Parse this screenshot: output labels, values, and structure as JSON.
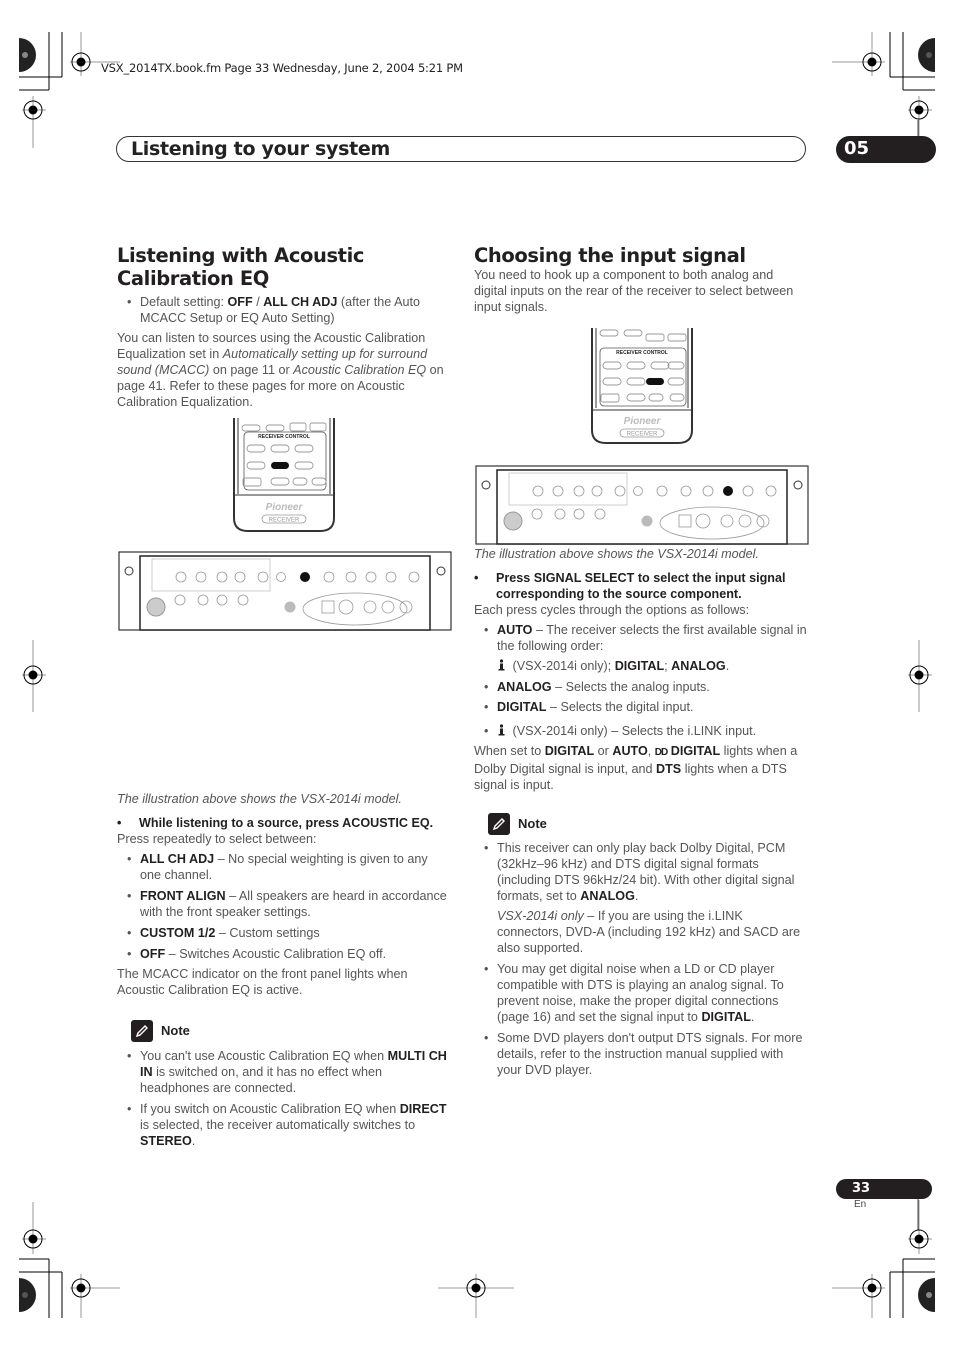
{
  "print_header": "VSX_2014TX.book.fm  Page 33  Wednesday, June 2, 2004  5:21 PM",
  "chapter": {
    "title": "Listening to your system",
    "number": "05"
  },
  "footer": {
    "page_number": "33",
    "language": "En"
  },
  "left": {
    "heading": "Listening with Acoustic Calibration EQ",
    "default_setting": {
      "prefix": "Default setting: ",
      "value1": "OFF",
      "sep": " / ",
      "value2": "ALL CH ADJ",
      "suffix": " (after the Auto MCACC Setup or EQ Auto Setting)"
    },
    "intro": {
      "t1": "You can listen to sources using the Acoustic Calibration Equalization set in ",
      "i1": "Automatically setting up for surround sound (MCACC)",
      "t2": " on page 11 or ",
      "i2": "Acoustic Calibration EQ",
      "t3": " on page 41. Refer to these pages for more on Acoustic Calibration Equalization."
    },
    "remote": {
      "section_label": "RECEIVER CONTROL",
      "highlight_button": "ACOUSTIC EQ",
      "brand": "Pioneer",
      "badge": "RECEIVER"
    },
    "panel": {
      "highlight_button": "ACOUSTIC EQ"
    },
    "caption": "The illustration above shows the VSX-2014i model.",
    "step": "While listening to a source, press ACOUSTIC EQ.",
    "step_sub": "Press repeatedly to select between:",
    "options": [
      {
        "name": "ALL CH ADJ",
        "desc": " – No special weighting is given to any one channel."
      },
      {
        "name": "FRONT ALIGN",
        "desc": " – All speakers are heard in accordance with the front speaker settings."
      },
      {
        "name": "CUSTOM 1/2",
        "desc": " – Custom settings"
      },
      {
        "name": "OFF",
        "desc": " – Switches Acoustic Calibration EQ off."
      }
    ],
    "after": "The MCACC indicator on the front panel lights when Acoustic Calibration EQ is active.",
    "note": {
      "title": "Note",
      "items": [
        {
          "t1": "You can't use Acoustic Calibration EQ when ",
          "b1": "MULTI CH IN",
          "t2": " is switched on, and it has no effect when headphones are connected."
        },
        {
          "t1": "If you switch on Acoustic Calibration EQ when ",
          "b1": "DIRECT",
          "t2": " is selected, the receiver automatically switches to ",
          "b2": "STEREO",
          "t3": "."
        }
      ]
    }
  },
  "right": {
    "heading": "Choosing the input signal",
    "intro": "You need to hook up a component to both analog and digital inputs on the rear of the receiver to select between input signals.",
    "remote": {
      "section_label": "RECEIVER CONTROL",
      "highlight_button": "SIGNAL SELECT",
      "brand": "Pioneer",
      "badge": "RECEIVER"
    },
    "panel": {
      "highlight_button": "SIGNAL SELECT"
    },
    "caption": "The illustration above shows the VSX-2014i model.",
    "step": "Press SIGNAL SELECT to select the input signal corresponding to the source component.",
    "step_sub": "Each press cycles through the options as follows:",
    "auto": {
      "name": "AUTO",
      "desc": " – The receiver selects the first available signal in the following order:"
    },
    "auto_order": {
      "t1": " (VSX-2014i only); ",
      "b1": "DIGITAL",
      "sep": "; ",
      "b2": "ANALOG",
      "end": "."
    },
    "options": [
      {
        "name": "ANALOG",
        "desc": " – Selects the analog inputs."
      },
      {
        "name": "DIGITAL",
        "desc": " – Selects the digital input."
      }
    ],
    "ilink_option": " (VSX-2014i only) – Selects the i.LINK input.",
    "after": {
      "t1": "When set to ",
      "b1": "DIGITAL",
      "t2": " or ",
      "b2": "AUTO",
      "t3": ", ",
      "dd": "DD",
      "b3": " DIGITAL",
      "t4": " lights when a Dolby Digital signal is input, and ",
      "b4": "DTS",
      "t5": " lights when a DTS signal is input."
    },
    "note": {
      "title": "Note",
      "items": [
        {
          "t1": "This receiver can only play back Dolby Digital, PCM (32kHz–96 kHz) and DTS digital signal formats (including DTS 96kHz/24 bit). With other digital signal formats, set to ",
          "b1": "ANALOG",
          "t2": "."
        },
        {
          "t1": "You may get digital noise when a LD or CD player compatible with DTS is playing an analog signal. To prevent noise, make the proper digital connections (page 16) and set the signal input to ",
          "b1": "DIGITAL",
          "t2": "."
        },
        {
          "t1": "Some DVD players don't output DTS signals. For more details, refer to the instruction manual supplied with your DVD player."
        }
      ],
      "sub": {
        "i1": "VSX-2014i only",
        "t1": " – If you are using the i.LINK connectors, DVD-A (including 192 kHz) and SACD are also supported."
      }
    }
  }
}
